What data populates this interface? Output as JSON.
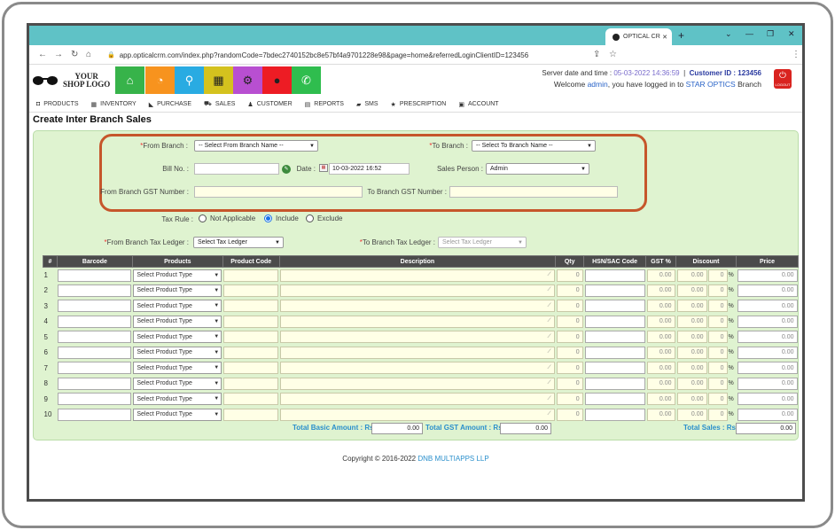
{
  "browser": {
    "tab_title": "OPTICAL CR",
    "new_tab": "+",
    "url": "app.opticalcrm.com/index.php?randomCode=7bdec2740152bc8e57bf4a9701228e98&page=home&referredLoginClientID=123456"
  },
  "header": {
    "logo_line1": "YOUR",
    "logo_line2": "SHOP LOGO",
    "server_label": "Server date and time :",
    "server_time": "05-03-2022 14:36:59",
    "customer_label": "Customer ID :",
    "customer_id": "123456",
    "welcome_prefix": "Welcome",
    "user": "admin",
    "welcome_mid": ", you have logged in to",
    "branch": "STAR OPTICS",
    "branch_suffix": "Branch",
    "logout_label": "LOGOUT",
    "icon_colors": [
      "#37b34a",
      "#f7931e",
      "#29abe2",
      "#d4c21e",
      "#b84fd1",
      "#ed1c24",
      "#2fbd4e"
    ]
  },
  "menu": [
    {
      "label": "PRODUCTS",
      "icon": "box-icon"
    },
    {
      "label": "INVENTORY",
      "icon": "grid-icon"
    },
    {
      "label": "PURCHASE",
      "icon": "tag-icon"
    },
    {
      "label": "SALES",
      "icon": "cart-icon"
    },
    {
      "label": "CUSTOMER",
      "icon": "user-icon"
    },
    {
      "label": "REPORTS",
      "icon": "file-icon"
    },
    {
      "label": "SMS",
      "icon": "chat-icon"
    },
    {
      "label": "PRESCRIPTION",
      "icon": "star-icon"
    },
    {
      "label": "ACCOUNT",
      "icon": "lock-icon"
    }
  ],
  "page": {
    "title": "Create Inter Branch Sales"
  },
  "form": {
    "from_branch_label": "From Branch :",
    "from_branch_value": "-- Select From Branch Name --",
    "to_branch_label": "To Branch :",
    "to_branch_value": "-- Select To Branch Name --",
    "bill_no_label": "Bill No. :",
    "bill_no_value": "",
    "date_label": "Date :",
    "date_value": "10-03-2022 16:52",
    "sales_person_label": "Sales Person :",
    "sales_person_value": "Admin",
    "from_gst_label": "From Branch GST Number :",
    "from_gst_value": "",
    "to_gst_label": "To Branch GST Number :",
    "to_gst_value": "",
    "tax_rule_label": "Tax Rule :",
    "tax_options": [
      "Not Applicable",
      "Include",
      "Exclude"
    ],
    "tax_selected": "Include",
    "from_tax_ledger_label": "From Branch Tax Ledger :",
    "from_tax_ledger_value": "Select Tax Ledger",
    "to_tax_ledger_label": "To Branch Tax Ledger :",
    "to_tax_ledger_value": "Select Tax Ledger"
  },
  "table": {
    "headers": [
      "#",
      "Barcode",
      "Products",
      "Product Code",
      "Description",
      "Qty",
      "HSN/SAC Code",
      "GST %",
      "Discount",
      "Price"
    ],
    "product_placeholder": "Select Product Type",
    "qty_default": "0",
    "gst_default": "0.00",
    "discount_default": "0.00",
    "discount_pct_default": "0",
    "pct_symbol": "%",
    "price_default": "0.00",
    "rows": [
      "1",
      "2",
      "3",
      "4",
      "5",
      "6",
      "7",
      "8",
      "9",
      "10"
    ]
  },
  "totals": {
    "basic_label": "Total Basic Amount : Rs",
    "basic_value": "0.00",
    "gst_label": "Total GST Amount : Rs",
    "gst_value": "0.00",
    "sales_label": "Total Sales : Rs",
    "sales_value": "0.00"
  },
  "footer": {
    "copyright": "Copyright © 2016-2022",
    "company": "DNB MULTIAPPS LLP"
  }
}
